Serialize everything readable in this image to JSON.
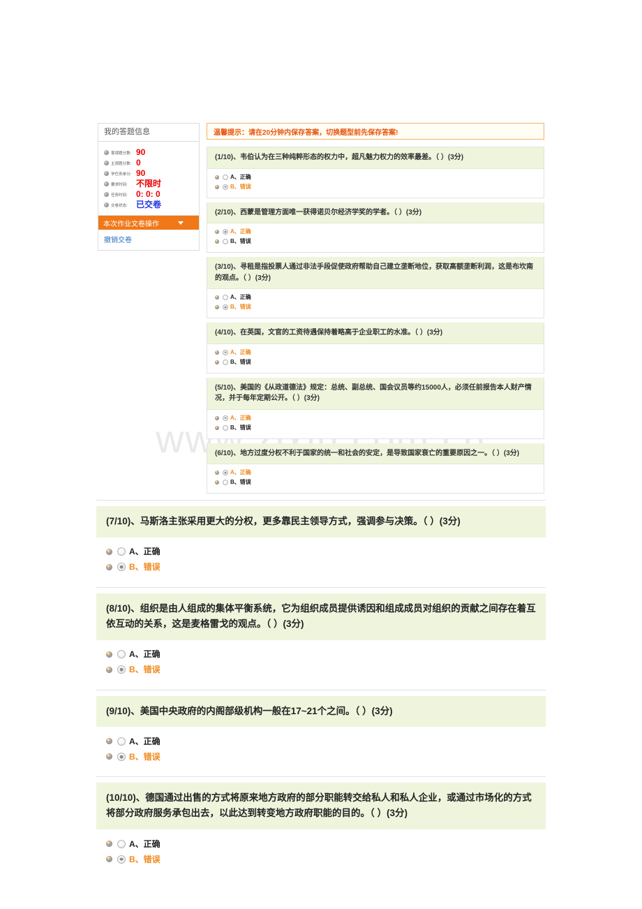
{
  "watermark": "www.zixin.com.cn",
  "sidebar": {
    "header_title": "我的答题信息",
    "stats": [
      {
        "label": "客观题分数:",
        "value": "90",
        "color": "red"
      },
      {
        "label": "主观题分数:",
        "value": "0",
        "color": "red"
      },
      {
        "label": "学任务单分:",
        "value": "90",
        "color": "red"
      },
      {
        "label": "要求时间:",
        "value": "不限时",
        "color": "red"
      },
      {
        "label": "任务时间:",
        "value": "0: 0: 0",
        "color": "red"
      },
      {
        "label": "交卷状态:",
        "value": "已交卷",
        "color": "blue"
      }
    ],
    "action_bar_label": "本次作业文卷操作",
    "links": [
      {
        "label": "撤销交卷"
      }
    ]
  },
  "notice": {
    "text": "温馨提示：请在20分钟内保存答案，切换题型前先保存答案!"
  },
  "questions": [
    {
      "stem": "(1/10)、韦伯认为在三种纯粹形态的权力中，超凡魅力权力的效率最差。（  ）(3分)",
      "options": [
        {
          "label": "A、正确",
          "checked": false
        },
        {
          "label": "B、错误",
          "checked": true
        }
      ]
    },
    {
      "stem": "(2/10)、西蒙是管理方面唯一获得诺贝尔经济学奖的学者。（  ）(3分)",
      "options": [
        {
          "label": "A、正确",
          "checked": true
        },
        {
          "label": "B、错误",
          "checked": false
        }
      ]
    },
    {
      "stem": "(3/10)、寻租是指投票人通过非法手段促使政府帮助自己建立垄断地位，获取高额垄断利润，这是布坎南的观点。（  ）(3分)",
      "options": [
        {
          "label": "A、正确",
          "checked": false
        },
        {
          "label": "B、错误",
          "checked": true
        }
      ]
    },
    {
      "stem": "(4/10)、在英国，文官的工资待遇保持着略高于企业职工的水准。（  ）(3分)",
      "options": [
        {
          "label": "A、正确",
          "checked": true
        },
        {
          "label": "B、错误",
          "checked": false
        }
      ]
    },
    {
      "stem": "(5/10)、美国的《从政道德法》规定：总统、副总统、国会议员等约15000人，必须任前报告本人财产情况，并于每年定期公开。（  ）(3分)",
      "options": [
        {
          "label": "A、正确",
          "checked": true
        },
        {
          "label": "B、错误",
          "checked": false
        }
      ]
    },
    {
      "stem": "(6/10)、地方过度分权不利于国家的统一和社会的安定，是导致国家衰亡的重要原因之一。（  ）(3分)",
      "options": [
        {
          "label": "A、正确",
          "checked": true
        },
        {
          "label": "B、错误",
          "checked": false
        }
      ]
    },
    {
      "stem": "(7/10)、马斯洛主张采用更大的分权，更多靠民主领导方式，强调参与决策。（  ）(3分)",
      "options": [
        {
          "label": "A、正确",
          "checked": false
        },
        {
          "label": "B、错误",
          "checked": true
        }
      ]
    },
    {
      "stem": "(8/10)、组织是由人组成的集体平衡系统，它为组织成员提供诱因和组成成员对组织的贡献之间存在着互依互动的关系，这是麦格雷戈的观点。（  ）(3分)",
      "options": [
        {
          "label": "A、正确",
          "checked": false
        },
        {
          "label": "B、错误",
          "checked": true
        }
      ]
    },
    {
      "stem": "(9/10)、美国中央政府的内阁部级机构一般在17~21个之间。（  ）(3分)",
      "options": [
        {
          "label": "A、正确",
          "checked": false
        },
        {
          "label": "B、错误",
          "checked": true
        }
      ]
    },
    {
      "stem": "(10/10)、德国通过出售的方式将原来地方政府的部分职能转交给私人和私人企业，或通过市场化的方式将部分政府服务承包出去，以此达到转变地方政府职能的目的。（  ）(3分)",
      "options": [
        {
          "label": "A、正确",
          "checked": false
        },
        {
          "label": "B、错误",
          "checked": true
        }
      ]
    }
  ],
  "colors": {
    "accent_orange": "#f07818",
    "stem_green": "#eef5dc",
    "notice_border": "#f0b36b",
    "notice_text": "#e8550e",
    "link_blue": "#2a6fc0",
    "value_red": "#ee0000",
    "value_blue": "#2233dd",
    "marked_option": "#f08a1e"
  }
}
